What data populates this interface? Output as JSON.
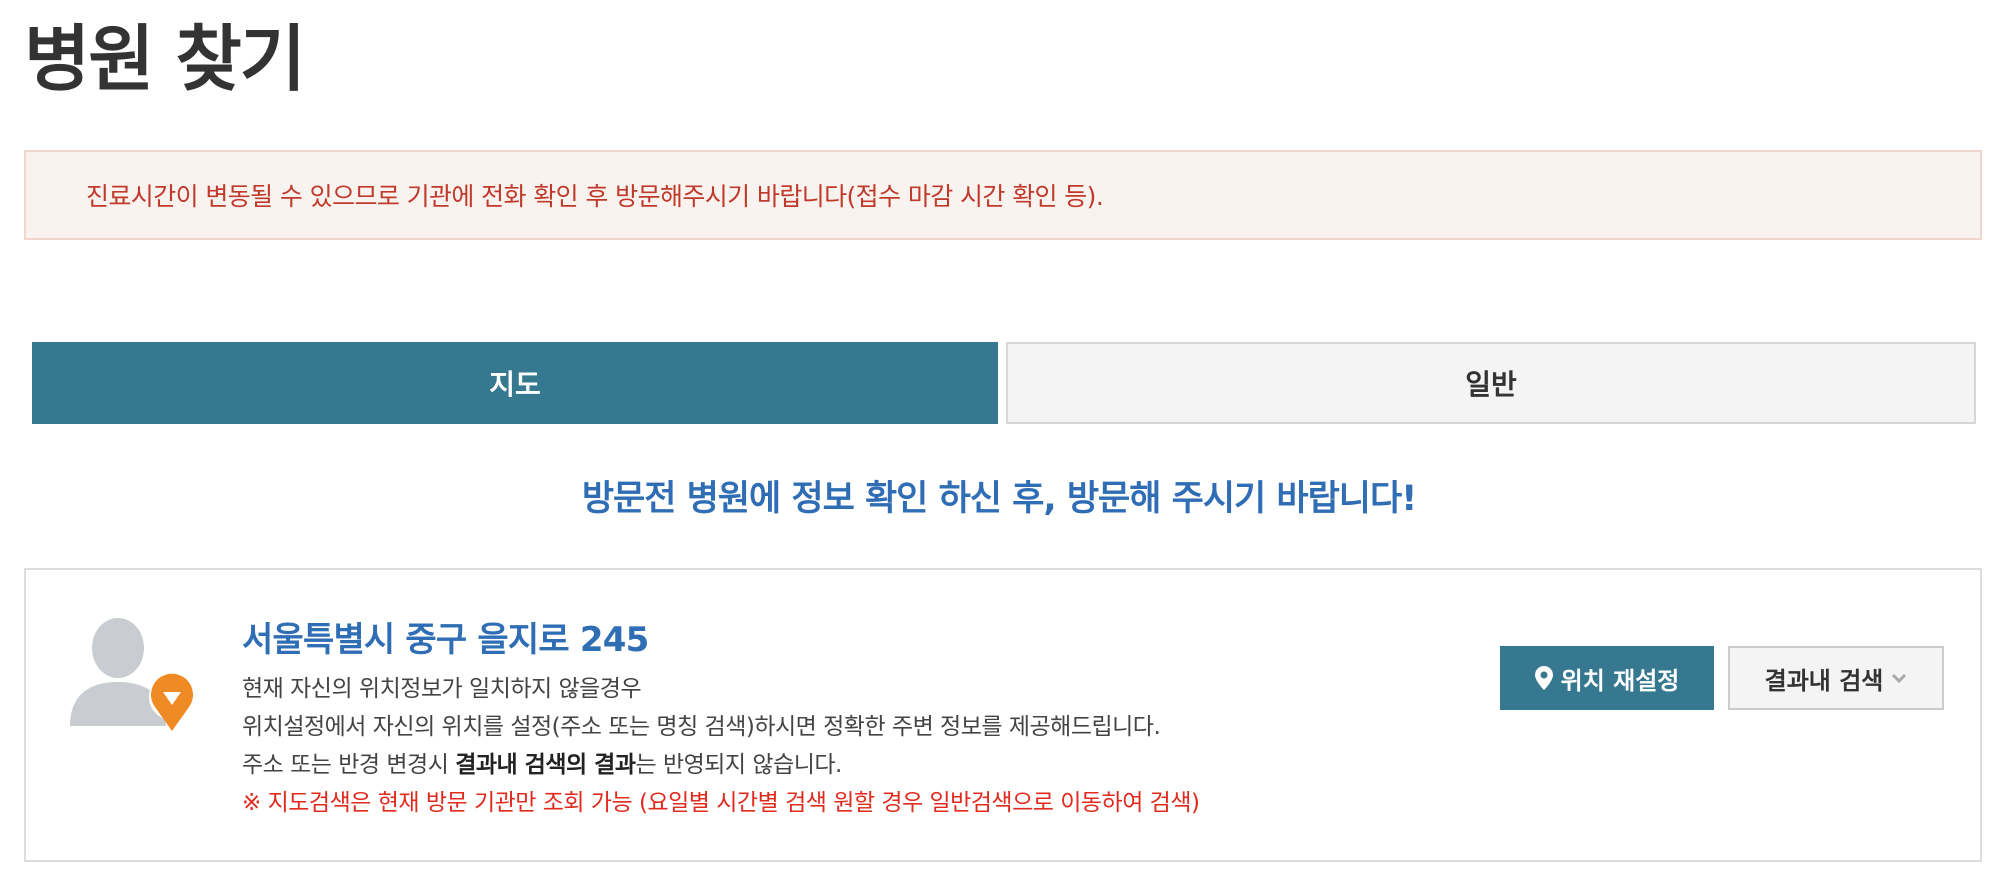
{
  "page": {
    "title": "병원 찾기"
  },
  "notice": {
    "text": "진료시간이 변동될 수 있으므로 기관에 전화 확인 후 방문해주시기 바랍니다(접수 마감 시간 확인 등)."
  },
  "tabs": [
    {
      "label": "지도",
      "active": true
    },
    {
      "label": "일반",
      "active": false
    }
  ],
  "headline": "방문전 병원에 정보 확인 하신 후, 방문해 주시기 바랍니다!",
  "location": {
    "address": "서울특별시 중구 을지로 245",
    "line1": "현재 자신의 위치정보가 일치하지 않을경우",
    "line2": "위치설정에서 자신의 위치를 설정(주소 또는 명칭 검색)하시면 정확한 주변 정보를 제공해드립니다.",
    "line3_pre": "주소 또는 반경 변경시 ",
    "line3_strong": "결과내 검색의 결과",
    "line3_post": "는 반영되지 않습니다.",
    "warning": "※ 지도검색은 현재 방문 기관만 조회 가능 (요일별 시간별 검색 원할 경우 일반검색으로 이동하여 검색)",
    "avatar_icon": "person-with-location-pin-icon"
  },
  "buttons": {
    "relocate_label": "위치 재설정",
    "relocate_icon": "map-pin-icon",
    "search_label": "결과내 검색",
    "search_icon": "chevron-down-icon"
  },
  "colors": {
    "primary": "#35788f",
    "headline_blue": "#2f6db5",
    "notice_red": "#c0392b",
    "warning_red": "#e02b1e",
    "avatar_orange": "#f08a24"
  }
}
